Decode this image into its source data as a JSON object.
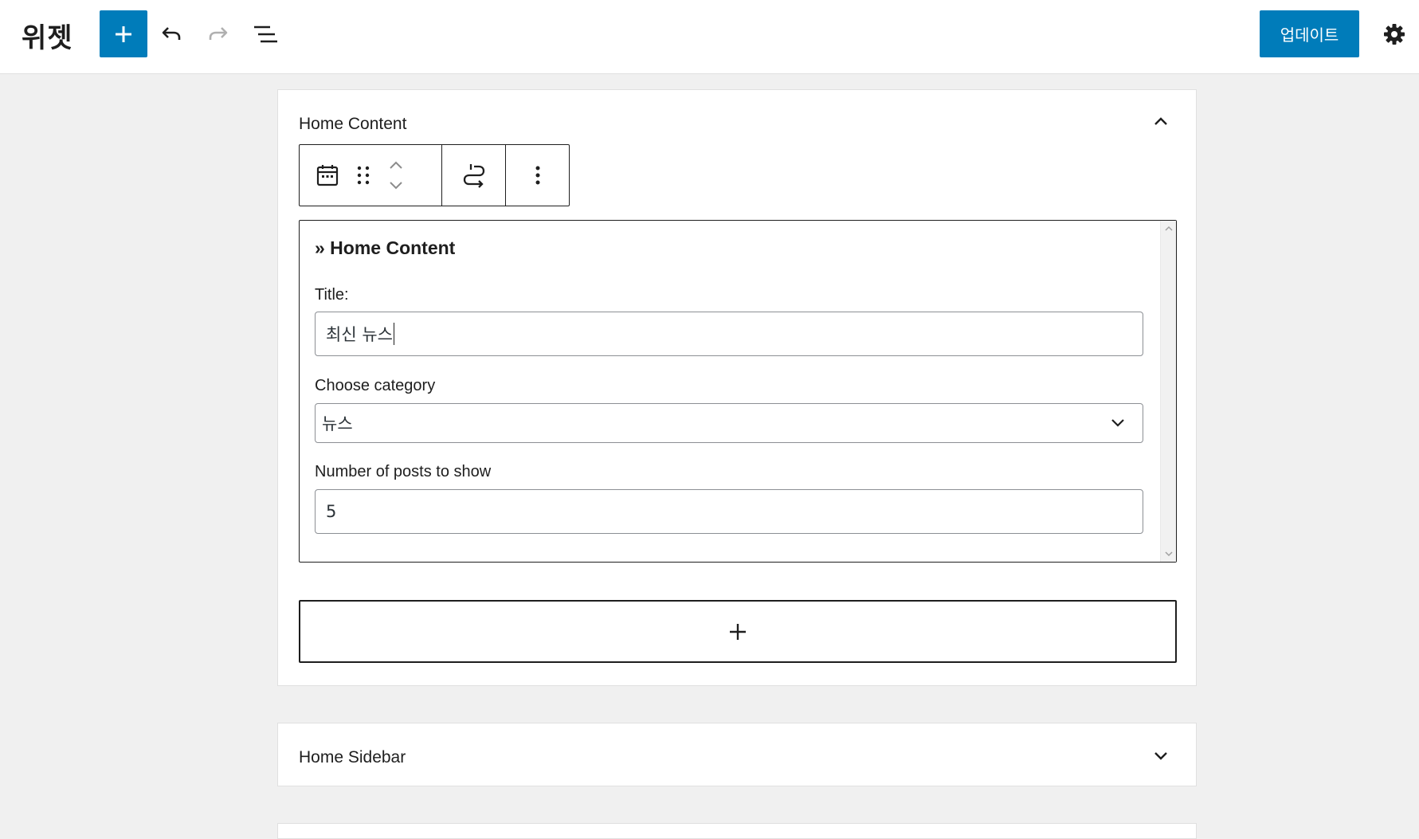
{
  "header": {
    "title": "위젯",
    "add_block_icon": "plus-icon",
    "undo_icon": "undo-icon",
    "redo_icon": "redo-icon",
    "list_view_icon": "list-view-icon",
    "update_label": "업데이트",
    "settings_icon": "gear-icon"
  },
  "widget_areas": [
    {
      "title": "Home Content",
      "expanded": true,
      "toolbar": {
        "block_icon": "calendar-icon",
        "drag_icon": "drag-handle-icon",
        "move_up_icon": "chevron-up-icon",
        "move_down_icon": "chevron-down-icon",
        "transform_icon": "transform-icon",
        "more_icon": "more-vertical-icon"
      },
      "widget": {
        "heading": "» Home Content",
        "fields": {
          "title_label": "Title:",
          "title_value": "최신 뉴스",
          "category_label": "Choose category",
          "category_value": "뉴스",
          "posts_label": "Number of posts to show",
          "posts_value": "5"
        }
      },
      "appender_icon": "plus-icon"
    },
    {
      "title": "Home Sidebar",
      "expanded": false
    }
  ],
  "colors": {
    "accent": "#007cba",
    "background": "#f0f0f0",
    "text": "#1e1e1e"
  }
}
